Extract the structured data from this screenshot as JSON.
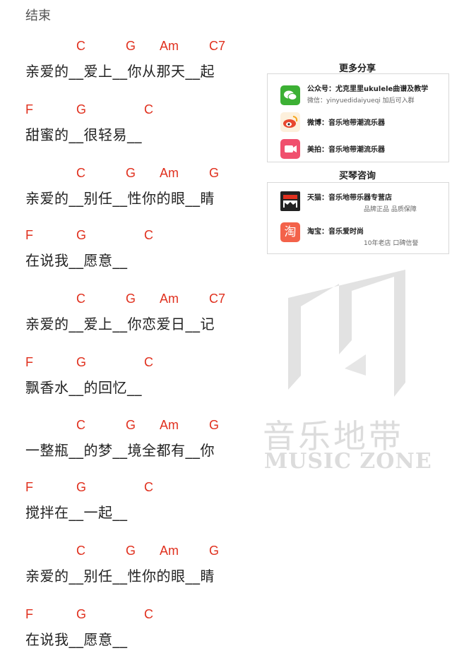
{
  "section_label": "结束",
  "stanzas": [
    {
      "chords": [
        "C",
        "G",
        "Am",
        "C7"
      ],
      "lyric": "亲爱的__爱上__你从那天__起"
    },
    {
      "chords": [
        "F",
        "G",
        "C"
      ],
      "lyric": "甜蜜的__很轻易__"
    },
    {
      "chords": [
        "C",
        "G",
        "Am",
        "G"
      ],
      "lyric": "亲爱的__别任__性你的眼__睛"
    },
    {
      "chords": [
        "F",
        "G",
        "C"
      ],
      "lyric": "在说我__愿意__"
    },
    {
      "chords": [
        "C",
        "G",
        "Am",
        "C7"
      ],
      "lyric": "亲爱的__爱上__你恋爱日__记"
    },
    {
      "chords": [
        "F",
        "G",
        "C"
      ],
      "lyric": "飘香水__的回忆__"
    },
    {
      "chords": [
        "C",
        "G",
        "Am",
        "G"
      ],
      "lyric": "一整瓶__的梦__境全都有__你"
    },
    {
      "chords": [
        "F",
        "G",
        "C"
      ],
      "lyric": "搅拌在__一起__"
    },
    {
      "chords": [
        "C",
        "G",
        "Am",
        "G"
      ],
      "lyric": "亲爱的__别任__性你的眼__睛"
    },
    {
      "chords": [
        "F",
        "G",
        "C"
      ],
      "lyric": "在说我__愿意__"
    }
  ],
  "share": {
    "title": "更多分享",
    "items": [
      {
        "icon": "wechat-icon",
        "label": "公众号：尤克里里ukulele曲谱及教学",
        "sub": "微信：yinyuedidaiyueqi  加后可入群"
      },
      {
        "icon": "weibo-icon",
        "label": "微博：音乐地带潮流乐器"
      },
      {
        "icon": "meipai-icon",
        "label": "美拍：音乐地带潮流乐器"
      }
    ]
  },
  "buy": {
    "title": "买琴咨询",
    "items": [
      {
        "icon": "tmall-icon",
        "label": "天猫：音乐地带乐器专营店",
        "sub": "品牌正品 品质保障"
      },
      {
        "icon": "taobao-icon",
        "glyph": "淘",
        "label": "淘宝：音乐爱时尚",
        "sub": "10年老店 口碑信誉"
      }
    ]
  },
  "watermark": {
    "cn": "音乐地带",
    "en": "MUSIC ZONE"
  },
  "colors": {
    "chord": "#e0301e",
    "wechat": "#3cb034",
    "weibo": "#f7a51c",
    "meipai": "#f0506e",
    "tmall": "#222222",
    "taobao": "#f3624a"
  }
}
